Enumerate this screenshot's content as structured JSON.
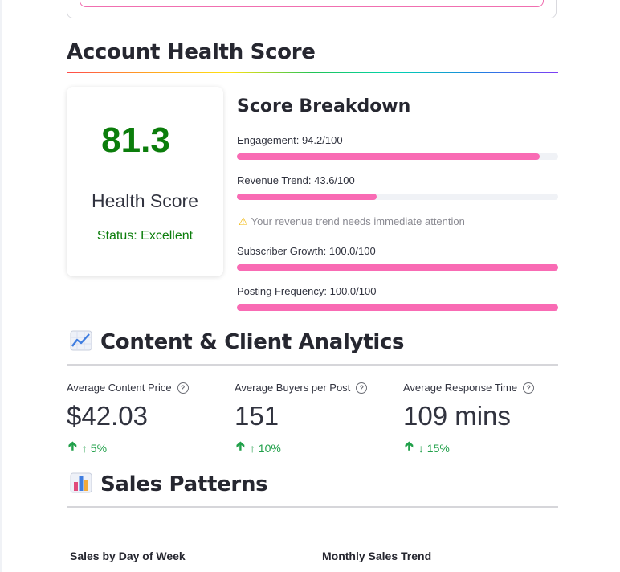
{
  "health": {
    "section_title": "Account Health Score",
    "score": "81.3",
    "score_label": "Health Score",
    "status": "Status: Excellent"
  },
  "breakdown": {
    "title": "Score Breakdown",
    "items": [
      {
        "label": "Engagement: 94.2/100",
        "value": 94.2
      },
      {
        "label": "Revenue Trend: 43.6/100",
        "value": 43.6
      },
      {
        "label": "Subscriber Growth: 100.0/100",
        "value": 100.0
      },
      {
        "label": "Posting Frequency: 100.0/100",
        "value": 100.0
      }
    ],
    "warning": "Your revenue trend needs immediate attention",
    "warning_icon": "warning-icon"
  },
  "content": {
    "section_title": "Content & Client Analytics",
    "icon": "chart-increasing-icon",
    "kpis": [
      {
        "label": "Average Content Price",
        "value": "$42.03",
        "delta": "5%",
        "delta_dir_icon": "arrow-up-small-icon"
      },
      {
        "label": "Average Buyers per Post",
        "value": "151",
        "delta": "10%",
        "delta_dir_icon": "arrow-up-small-icon"
      },
      {
        "label": "Average Response Time",
        "value": "109 mins",
        "delta": "15%",
        "delta_dir_icon": "arrow-down-small-icon"
      }
    ]
  },
  "sales": {
    "section_title": "Sales Patterns",
    "icon": "bar-chart-icon",
    "sub_left": "Sales by Day of Week",
    "sub_right": "Monthly Sales Trend"
  },
  "colors": {
    "bar_fill": "#f96bb4",
    "score_green": "#0b7d0b",
    "delta_green": "#21a04a"
  }
}
